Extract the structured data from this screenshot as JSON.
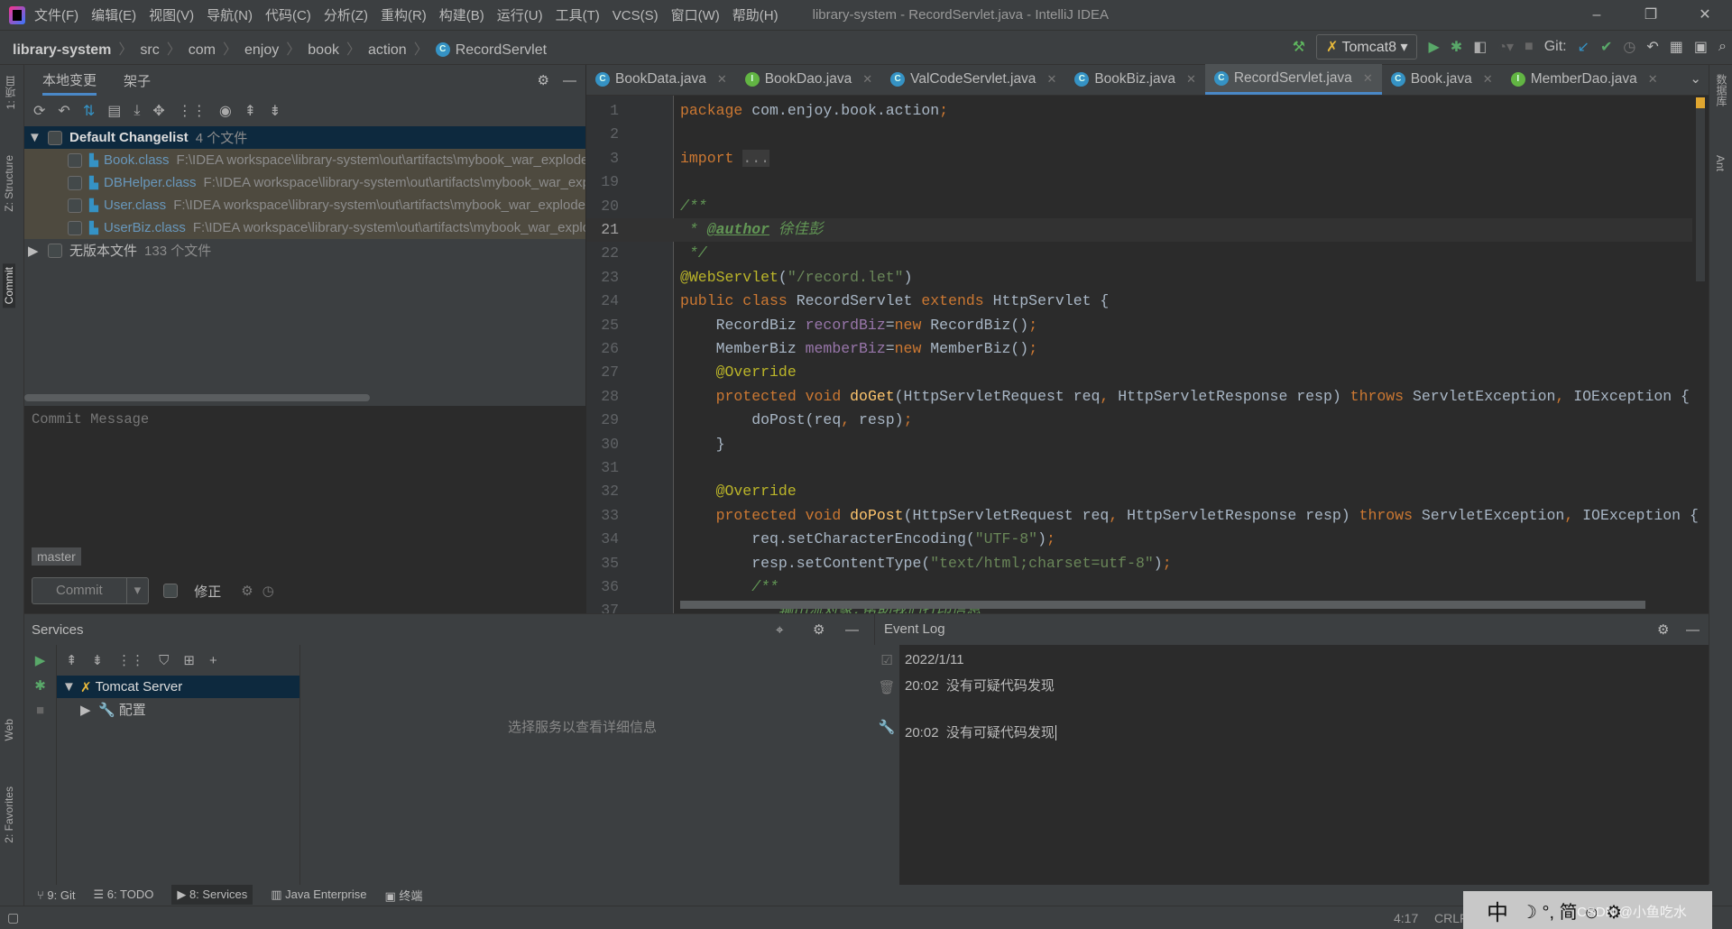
{
  "window": {
    "title": "library-system - RecordServlet.java - IntelliJ IDEA",
    "minimize": "–",
    "restore": "❐",
    "close": "✕"
  },
  "menu": [
    "文件(F)",
    "编辑(E)",
    "视图(V)",
    "导航(N)",
    "代码(C)",
    "分析(Z)",
    "重构(R)",
    "构建(B)",
    "运行(U)",
    "工具(T)",
    "VCS(S)",
    "窗口(W)",
    "帮助(H)"
  ],
  "breadcrumb": [
    "library-system",
    "src",
    "com",
    "enjoy",
    "book",
    "action",
    "RecordServlet"
  ],
  "toolbar": {
    "run_config": "Tomcat8",
    "git_label": "Git:"
  },
  "left_strip": {
    "project": "1: 项目",
    "structure": "Z: Structure",
    "commit": "Commit",
    "web": "Web",
    "favorites": "2: Favorites"
  },
  "right_strip": {
    "database": "数据库",
    "ant": "Ant"
  },
  "commit_panel": {
    "tabs": [
      "本地变更",
      "架子"
    ],
    "changelist": {
      "name": "Default Changelist",
      "count": "4 个文件",
      "files": [
        {
          "name": "Book.class",
          "path": "F:\\IDEA workspace\\library-system\\out\\artifacts\\mybook_war_exploded"
        },
        {
          "name": "DBHelper.class",
          "path": "F:\\IDEA workspace\\library-system\\out\\artifacts\\mybook_war_exploded"
        },
        {
          "name": "User.class",
          "path": "F:\\IDEA workspace\\library-system\\out\\artifacts\\mybook_war_exploded"
        },
        {
          "name": "UserBiz.class",
          "path": "F:\\IDEA workspace\\library-system\\out\\artifacts\\mybook_war_exploded"
        }
      ]
    },
    "unversioned": {
      "name": "无版本文件",
      "count": "133 个文件"
    },
    "message_placeholder": "Commit Message",
    "branch": "master",
    "commit_button": "Commit",
    "amend_label": "修正"
  },
  "editor": {
    "tabs": [
      {
        "label": "BookData.java",
        "kind": "C",
        "active": false
      },
      {
        "label": "BookDao.java",
        "kind": "I",
        "active": false
      },
      {
        "label": "ValCodeServlet.java",
        "kind": "C",
        "active": false
      },
      {
        "label": "BookBiz.java",
        "kind": "C",
        "active": false
      },
      {
        "label": "RecordServlet.java",
        "kind": "C",
        "active": true
      },
      {
        "label": "Book.java",
        "kind": "C",
        "active": false
      },
      {
        "label": "MemberDao.java",
        "kind": "I",
        "active": false
      }
    ],
    "current_line": "21",
    "lines": [
      {
        "n": "1",
        "t": [
          [
            "kw",
            "package "
          ],
          [
            "",
            "com.enjoy.book.action"
          ],
          [
            "kw",
            ";"
          ]
        ]
      },
      {
        "n": "2",
        "t": []
      },
      {
        "n": "3",
        "t": [
          [
            "kw",
            "import "
          ],
          [
            "fold",
            "..."
          ]
        ]
      },
      {
        "n": "19",
        "t": []
      },
      {
        "n": "20",
        "t": [
          [
            "cm",
            "/**"
          ]
        ]
      },
      {
        "n": "21",
        "t": [
          [
            "cm",
            " * "
          ],
          [
            "tag",
            "@author"
          ],
          [
            "cm",
            " 徐佳彭"
          ]
        ]
      },
      {
        "n": "22",
        "t": [
          [
            "cm",
            " */"
          ]
        ]
      },
      {
        "n": "23",
        "t": [
          [
            "an",
            "@WebServlet"
          ],
          [
            "",
            "("
          ],
          [
            "st",
            "\"/record.let\""
          ],
          [
            "",
            ")"
          ]
        ]
      },
      {
        "n": "24",
        "t": [
          [
            "kw",
            "public class "
          ],
          [
            "",
            "RecordServlet "
          ],
          [
            "kw",
            "extends "
          ],
          [
            "",
            "HttpServlet {"
          ]
        ]
      },
      {
        "n": "25",
        "t": [
          [
            "",
            "    RecordBiz "
          ],
          [
            "fd",
            "recordBiz"
          ],
          [
            "",
            "="
          ],
          [
            "kw",
            "new "
          ],
          [
            "",
            "RecordBiz()"
          ],
          [
            "kw",
            ";"
          ]
        ]
      },
      {
        "n": "26",
        "t": [
          [
            "",
            "    MemberBiz "
          ],
          [
            "fd",
            "memberBiz"
          ],
          [
            "",
            "="
          ],
          [
            "kw",
            "new "
          ],
          [
            "",
            "MemberBiz()"
          ],
          [
            "kw",
            ";"
          ]
        ]
      },
      {
        "n": "27",
        "t": [
          [
            "an",
            "    @Override"
          ]
        ]
      },
      {
        "n": "28",
        "t": [
          [
            "kw",
            "    protected void "
          ],
          [
            "mt",
            "doGet"
          ],
          [
            "",
            "(HttpServletRequest req"
          ],
          [
            "kw",
            ", "
          ],
          [
            "",
            "HttpServletResponse resp) "
          ],
          [
            "kw",
            "throws "
          ],
          [
            "",
            "ServletException"
          ],
          [
            "kw",
            ", "
          ],
          [
            "",
            "IOException {"
          ]
        ]
      },
      {
        "n": "29",
        "t": [
          [
            "",
            "        doPost(req"
          ],
          [
            "kw",
            ", "
          ],
          [
            "",
            "resp)"
          ],
          [
            "kw",
            ";"
          ]
        ]
      },
      {
        "n": "30",
        "t": [
          [
            "",
            "    }"
          ]
        ]
      },
      {
        "n": "31",
        "t": []
      },
      {
        "n": "32",
        "t": [
          [
            "an",
            "    @Override"
          ]
        ]
      },
      {
        "n": "33",
        "t": [
          [
            "kw",
            "    protected void "
          ],
          [
            "mt",
            "doPost"
          ],
          [
            "",
            "(HttpServletRequest req"
          ],
          [
            "kw",
            ", "
          ],
          [
            "",
            "HttpServletResponse resp) "
          ],
          [
            "kw",
            "throws "
          ],
          [
            "",
            "ServletException"
          ],
          [
            "kw",
            ", "
          ],
          [
            "",
            "IOException {"
          ]
        ]
      },
      {
        "n": "34",
        "t": [
          [
            "",
            "        req.setCharacterEncoding("
          ],
          [
            "st",
            "\"UTF-8\""
          ],
          [
            "",
            ")"
          ],
          [
            "kw",
            ";"
          ]
        ]
      },
      {
        "n": "35",
        "t": [
          [
            "",
            "        resp.setContentType("
          ],
          [
            "st",
            "\"text/html;charset=utf-8\""
          ],
          [
            "",
            ")"
          ],
          [
            "kw",
            ";"
          ]
        ]
      },
      {
        "n": "36",
        "t": [
          [
            "cm",
            "        /**"
          ]
        ]
      },
      {
        "n": "37",
        "t": [
          [
            "cm",
            "         * 输出流对象,帮助我们打印信息"
          ]
        ]
      }
    ]
  },
  "services": {
    "title": "Services",
    "tree": [
      {
        "label": "Tomcat Server"
      },
      {
        "label": "配置"
      }
    ],
    "empty_hint": "选择服务以查看详细信息"
  },
  "event_log": {
    "title": "Event Log",
    "date": "2022/1/11",
    "entries": [
      {
        "time": "20:02",
        "text": "没有可疑代码发现"
      },
      {
        "time": "20:02",
        "text": "没有可疑代码发现"
      }
    ]
  },
  "tool_windows": [
    "9: Git",
    "6: TODO",
    "8: Services",
    "Java Enterprise",
    "终端"
  ],
  "status": {
    "position": "4:17",
    "line_sep": "CRLF"
  },
  "ime": {
    "lang": "中",
    "glyphs": "☽ °, 简 ☺ ⚙"
  },
  "watermark": "CSDN @小鱼吃水",
  "colors": {
    "keyword": "#cc7832",
    "annotation": "#bbb529",
    "string": "#6a8759",
    "field": "#9876aa",
    "method": "#ffc66d",
    "comment": "#629755",
    "selection": "#0d293e",
    "accent": "#4a88c7"
  }
}
